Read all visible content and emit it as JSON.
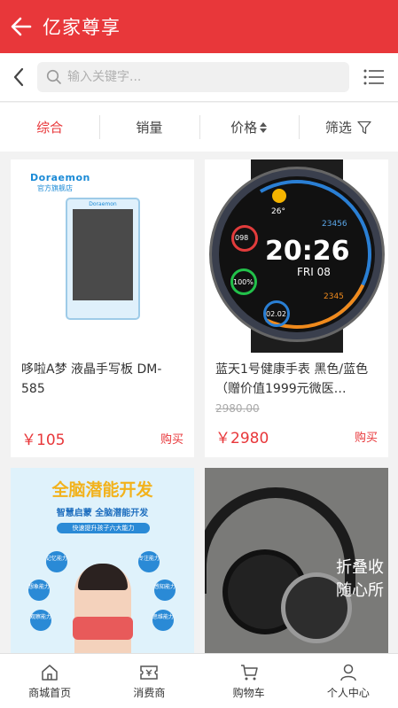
{
  "header": {
    "title": "亿家尊享"
  },
  "search": {
    "placeholder": "输入关键字..."
  },
  "sort": {
    "tabs": [
      "综合",
      "销量",
      "价格",
      "筛选"
    ]
  },
  "products": [
    {
      "name": "哆啦A梦 液晶手写板 DM-585",
      "price": "￥105",
      "buy": "购买",
      "image": {
        "brand": "Doraemon",
        "store": "官方旗舰店",
        "device_brand": "Doraemon"
      }
    },
    {
      "name": "蓝天1号健康手表 黑色/蓝色 （赠价值1999元微医…",
      "original_price": "2980.00",
      "price": "￥2980",
      "buy": "购买",
      "image": {
        "temp": "26°",
        "steps": "23456",
        "time": "20:26",
        "date": "FRI 08",
        "heart": "098",
        "battery": "100%",
        "ring": "02.02",
        "calories": "2345"
      }
    },
    {
      "image": {
        "headline": "全脑潜能开发",
        "sub": "智慧启蒙 全脑潜能开发",
        "tag": "快速提升孩子六大能力",
        "abilities": [
          "记忆能力",
          "专注能力",
          "想象能力",
          "感知能力",
          "观察能力",
          "思维能力"
        ]
      }
    },
    {
      "image": {
        "text1": "折叠收",
        "text2": "随心所"
      }
    }
  ],
  "tabbar": {
    "items": [
      "商城首页",
      "消费商",
      "购物车",
      "个人中心"
    ]
  },
  "colors": {
    "accent": "#e8373a"
  }
}
